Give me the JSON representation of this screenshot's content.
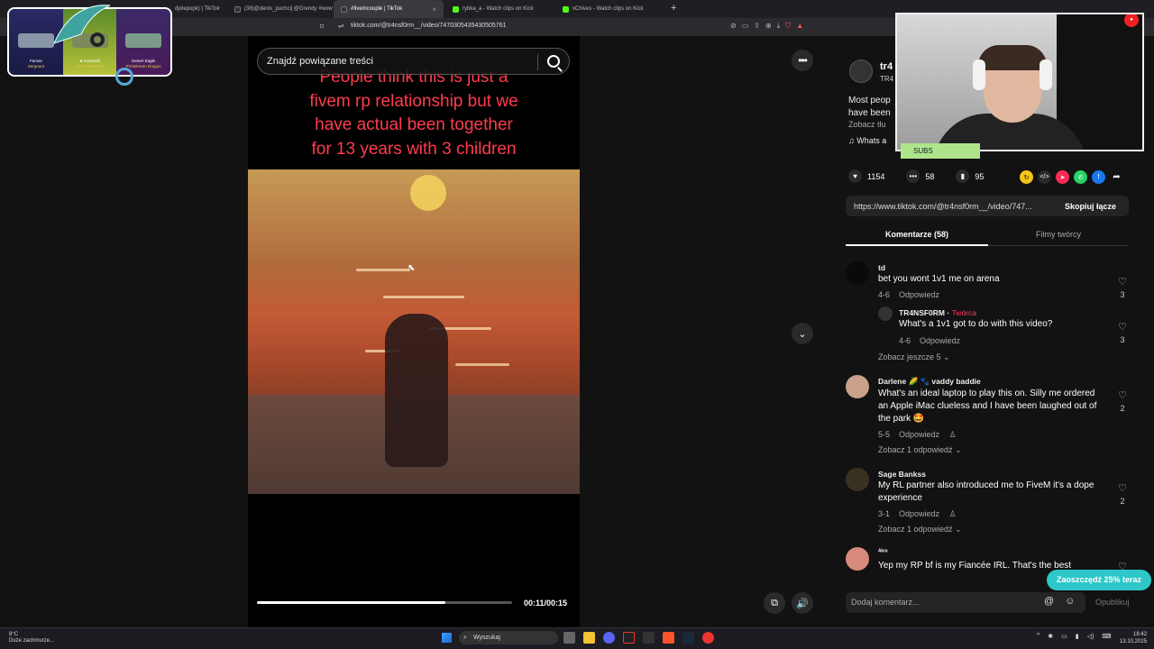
{
  "browser": {
    "tabs": [
      {
        "label": "djolepupk) | TikTok",
        "color": "#333",
        "active": false
      },
      {
        "label": "(38)@denis_puchcij @Grendy #wow",
        "color": "#333",
        "active": false
      },
      {
        "label": "#fivemcouple | TikTok",
        "color": "#333",
        "active": true
      },
      {
        "label": "rybka_a - Watch clips on Kick",
        "color": "#53fc18",
        "active": false
      },
      {
        "label": "xChives - Watch clips on Kick",
        "color": "#53fc18",
        "active": false
      }
    ],
    "url": "tiktok.com/@tr4nsf0rm__/video/7470305435430505761",
    "new_tab": "+"
  },
  "overlay": {
    "skins": [
      {
        "name": "Famas",
        "sub": "Sergeant"
      },
      {
        "name": "★ Karambit",
        "sub": "Case Hardened"
      },
      {
        "name": "Desert Eagle",
        "sub": "Printstream Dragon"
      }
    ],
    "subs_label": "SUBS"
  },
  "video": {
    "search_placeholder": "Znajdź powiązane treści",
    "caption_lines": [
      "People think this is just a",
      "fivem rp relationship but we",
      "have actual been together",
      "for 13 years with 3 children"
    ],
    "time": "00:11/00:15",
    "progress": 0.74
  },
  "author": {
    "name": "tr4",
    "handle": "TR4",
    "desc_line1": "Most peop",
    "desc_line2": "have been",
    "see_translation": "Zobacz tłu",
    "music": "♫  Whats a"
  },
  "stats": {
    "likes": "1154",
    "comments": "58",
    "saves": "95"
  },
  "link": {
    "url": "https://www.tiktok.com/@tr4nsf0rm__/video/747...",
    "copy_label": "Skopiuj łącze"
  },
  "tabs": {
    "comments": "Komentarze (58)",
    "creator_videos": "Filmy twórcy"
  },
  "comments": [
    {
      "user": "td",
      "text": "bet you wont 1v1 me on arena",
      "date": "4-6",
      "reply": "Odpowiedz",
      "likes": "3"
    },
    {
      "user": "TR4NSF0RM",
      "creator": "Twórca",
      "text": "What's a 1v1 got to do with this video?",
      "date": "4-6",
      "reply": "Odpowiedz",
      "likes": "3"
    },
    {
      "user": "Darlene 🌽 🐾 vaddy baddie",
      "text": "What's an ideal laptop to play this on. Silly me ordered an Apple iMac clueless and I have been laughed out of the park 🤩",
      "date": "5-5",
      "reply": "Odpowiedz",
      "likes": "2"
    },
    {
      "user": "Sage Bankss",
      "text": "My RL partner also introduced me to FiveM it's a dope experience",
      "date": "3-1",
      "reply": "Odpowiedz",
      "likes": "2"
    },
    {
      "user": "ᴬˡᶦᶜᵉ",
      "text": "Yep my RP bf is my Fiancée IRL. That's the best",
      "likes": ""
    }
  ],
  "see_more": {
    "c1": "Zobacz jeszcze 5",
    "c3": "Zobacz 1 odpowiedź",
    "c4": "Zobacz 1 odpowiedź"
  },
  "promo": "Zaoszczędź 25% teraz",
  "composer": {
    "placeholder": "Dodaj komentarz...",
    "publish": "Opublikuj"
  },
  "taskbar": {
    "weather_temp": "8°C",
    "weather_desc": "Dużе zachmurze...",
    "search": "Wyszukaj",
    "time": "18:42",
    "date": "13.10.2025"
  }
}
